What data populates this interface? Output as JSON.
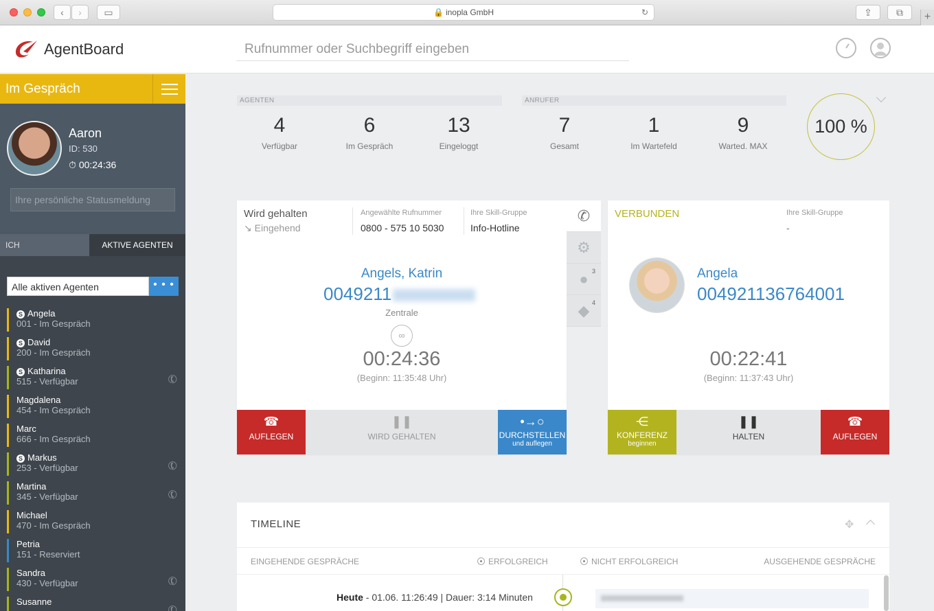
{
  "browser": {
    "url_label": "inopla GmbH"
  },
  "app": {
    "name": "AgentBoard",
    "search_placeholder": "Rufnummer oder Suchbegriff eingeben"
  },
  "sidebar": {
    "status": "Im Gespräch",
    "profile": {
      "name": "Aaron",
      "id": "ID: 530",
      "time": "00:24:36",
      "status_placeholder": "Ihre persönliche Statusmeldung"
    },
    "tabs": [
      "ICH",
      "AKTIVE AGENTEN"
    ],
    "filter": "Alle aktiven Agenten",
    "filter_button": "• • •",
    "agents": [
      {
        "name": "Angela",
        "status": "001 - Im Gespräch",
        "skill": true,
        "phone": false,
        "color": "#e8b811"
      },
      {
        "name": "David",
        "status": "200 - Im Gespräch",
        "skill": true,
        "phone": false,
        "color": "#e8b811"
      },
      {
        "name": "Katharina",
        "status": "515 - Verfügbar",
        "skill": true,
        "phone": true,
        "color": "#a9b51b"
      },
      {
        "name": "Magdalena",
        "status": "454 - Im Gespräch",
        "skill": false,
        "phone": false,
        "color": "#e8b811"
      },
      {
        "name": "Marc",
        "status": "666 - Im Gespräch",
        "skill": false,
        "phone": false,
        "color": "#e8b811"
      },
      {
        "name": "Markus",
        "status": "253 - Verfügbar",
        "skill": true,
        "phone": true,
        "color": "#a9b51b"
      },
      {
        "name": "Martina",
        "status": "345 - Verfügbar",
        "skill": false,
        "phone": true,
        "color": "#a9b51b"
      },
      {
        "name": "Michael",
        "status": "470 - Im Gespräch",
        "skill": false,
        "phone": false,
        "color": "#e8b811"
      },
      {
        "name": "Petria",
        "status": "151 - Reserviert",
        "skill": false,
        "phone": false,
        "color": "#3a88c9"
      },
      {
        "name": "Sandra",
        "status": "430 - Verfügbar",
        "skill": false,
        "phone": true,
        "color": "#a9b51b"
      },
      {
        "name": "Susanne",
        "status": "",
        "skill": false,
        "phone": true,
        "color": "#a9b51b"
      }
    ]
  },
  "stats": {
    "agents_header": "AGENTEN",
    "callers_header": "ANRUFER",
    "agents": [
      {
        "value": "4",
        "label": "Verfügbar"
      },
      {
        "value": "6",
        "label": "Im Gespräch"
      },
      {
        "value": "13",
        "label": "Eingeloggt"
      }
    ],
    "callers": [
      {
        "value": "7",
        "label": "Gesamt"
      },
      {
        "value": "1",
        "label": "Im Wartefeld"
      },
      {
        "value": "9",
        "label": "Warted. MAX"
      }
    ],
    "gauge": "100 %"
  },
  "call_held": {
    "state": "Wird gehalten",
    "direction": "Eingehend",
    "dialed_label": "Angewählte Rufnummer",
    "dialed": "0800 - 575 10 5030",
    "skill_label": "Ihre Skill-Gruppe",
    "skill": "Info-Hotline",
    "caller": "Angels, Katrin",
    "number": "0049211",
    "location": "Zentrale",
    "duration": "00:24:36",
    "start": "(Beginn: 11:35:48 Uhr)",
    "actions": {
      "hangup": "AUFLEGEN",
      "held": "WIRD GEHALTEN",
      "transfer": "DURCHSTELLEN",
      "transfer_sub": "und auflegen"
    },
    "side_badges": {
      "contacts": "3",
      "tags": "4"
    }
  },
  "call_connected": {
    "state": "VERBUNDEN",
    "skill_label": "Ihre Skill-Gruppe",
    "skill": "-",
    "caller": "Angela",
    "number": "004921136764001",
    "duration": "00:22:41",
    "start": "(Beginn: 11:37:43 Uhr)",
    "actions": {
      "conference": "KONFERENZ",
      "conference_sub": "beginnen",
      "hold": "HALTEN",
      "hangup": "AUFLEGEN"
    }
  },
  "timeline": {
    "title": "TIMELINE",
    "incoming": "EINGEHENDE GESPRÄCHE",
    "success": "ERFOLGREICH",
    "fail": "NICHT ERFOLGREICH",
    "outgoing": "AUSGEHENDE GESPRÄCHE",
    "entry_day": "Heute",
    "entry_rest": " - 01.06. 11:26:49 | Dauer: 3:14 Minuten"
  },
  "colors": {
    "yellow": "#e8b811",
    "red": "#c62b29",
    "blue": "#3a88c9",
    "olive": "#b3b31f",
    "sidebar": "#3e454c"
  }
}
